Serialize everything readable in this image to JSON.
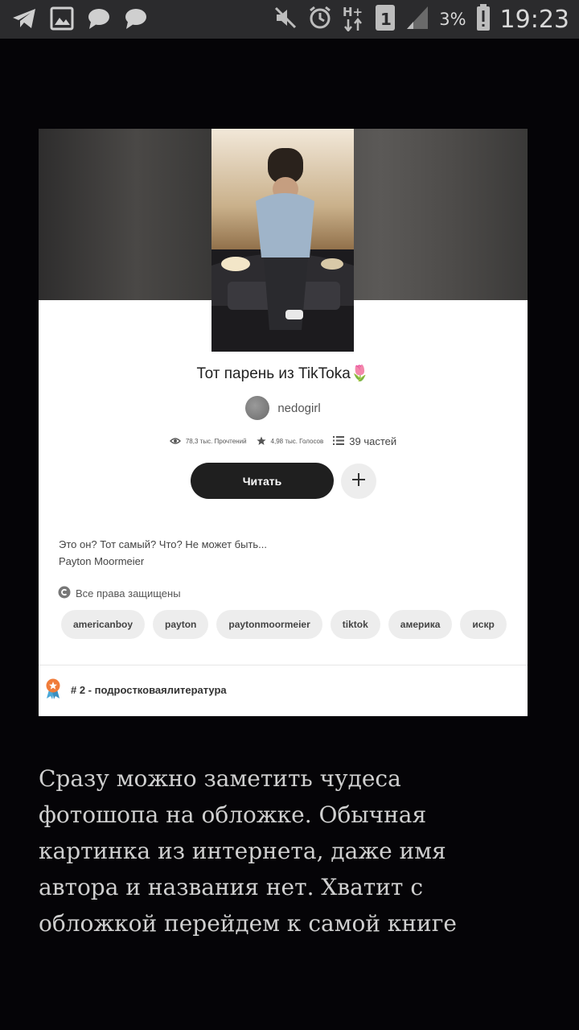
{
  "status_bar": {
    "icons_left": [
      "telegram-icon",
      "image-icon",
      "chat-bubble-icon",
      "chat-bubble-icon"
    ],
    "icons_right": [
      "mute-icon",
      "alarm-icon",
      "network-h-plus-icon",
      "sim-1-icon",
      "signal-icon",
      "battery-icon"
    ],
    "battery_percent": "3%",
    "time": "19:23"
  },
  "story": {
    "title": "Тот парень из TikToka",
    "title_emoji": "🌷",
    "author": "nedogirl",
    "reads": "78,3 тыс. Прочтений",
    "votes": "4,98 тыс. Голосов",
    "parts": "39 частей",
    "read_button": "Читать",
    "add_button": "+",
    "description_line1": "Это он? Тот самый? Что? Не может быть...",
    "description_line2": "Payton Moormeier",
    "rights": "Все права защищены",
    "tags": [
      "americanboy",
      "payton",
      "paytonmoormeier",
      "tiktok",
      "америка",
      "искр"
    ],
    "ranking": "# 2 - подростковаялитература"
  },
  "caption": {
    "line1": "Сразу можно заметить чудеса",
    "line2": "фотошопа на обложке. Обычная",
    "line3": "картинка из интернета, даже имя",
    "line4": "автора и названия нет. Хватит с",
    "line5": "обложкой перейдем к самой книге"
  }
}
